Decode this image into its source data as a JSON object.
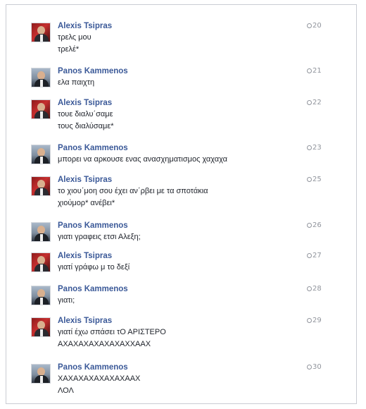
{
  "messages": [
    {
      "sender": "Alexis Tsipras",
      "avatar": "tsipras",
      "time": "20",
      "lines": [
        "τρελς μου",
        "τρελέ*"
      ]
    },
    {
      "sender": "Panos Kammenos",
      "avatar": "kammenos",
      "time": "21",
      "lines": [
        "ελα παιχτη"
      ]
    },
    {
      "sender": "Alexis Tsipras",
      "avatar": "tsipras",
      "time": "22",
      "lines": [
        "τουε διαλυ΄σαμε",
        "τους διαλύσαμε*"
      ]
    },
    {
      "sender": "Panos Kammenos",
      "avatar": "kammenos",
      "time": "23",
      "lines": [
        "μπορει να αρκουσε ενας ανασχηματισμος χαχαχα"
      ]
    },
    {
      "sender": "Alexis Tsipras",
      "avatar": "tsipras",
      "time": "25",
      "lines": [
        "το χιου΄μοη σου έχει αν΄ρβει με τα σποτάκια",
        "χιούμορ* ανέβει*"
      ]
    },
    {
      "sender": "Panos Kammenos",
      "avatar": "kammenos",
      "time": "26",
      "lines": [
        "γιατι γραφεις ετσι Αλεξη;"
      ]
    },
    {
      "sender": "Alexis Tsipras",
      "avatar": "tsipras",
      "time": "27",
      "lines": [
        "γιατί γράφω μ το δεξί"
      ]
    },
    {
      "sender": "Panos Kammenos",
      "avatar": "kammenos",
      "time": "28",
      "lines": [
        "γιατι;"
      ]
    },
    {
      "sender": "Alexis Tsipras",
      "avatar": "tsipras",
      "time": "29",
      "lines": [
        "γιατί έχω σπάσει τΟ ΑΡΙΣΤΕΡΟ",
        "ΑΧΑΧΑΧΑΧΑΧΑΧΑΧΧΑΑΧ"
      ]
    },
    {
      "sender": "Panos Kammenos",
      "avatar": "kammenos",
      "time": "30",
      "lines": [
        "ΧΑΧΑΧΑΧΑΧΑΧΑΧΑΑΧ",
        "ΛΟΛ"
      ]
    }
  ]
}
